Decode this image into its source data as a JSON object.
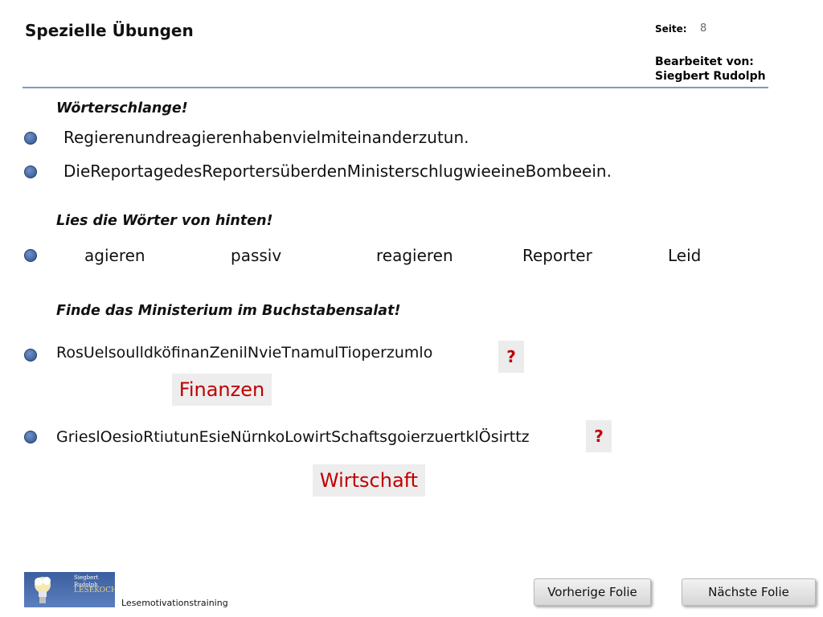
{
  "header": {
    "title": "Spezielle Übungen",
    "page_label": "Seite:",
    "page_number": "8",
    "edited_by_label": "Bearbeitet von:",
    "author": "Siegbert Rudolph"
  },
  "section1": {
    "heading": "Wörterschlange!",
    "lines": [
      "Regierenundreagierenhabenvielmiteinanderzutun.",
      "DieReportagedesReportersüberdenMinisterschlugwieeineBombeein."
    ]
  },
  "section2": {
    "heading": "Lies die Wörter von hinten!",
    "words": [
      "agieren",
      "passiv",
      "reagieren",
      "Reporter",
      "Leid"
    ]
  },
  "section3": {
    "heading": "Finde das Ministerium im Buchstabensalat!",
    "puzzles": [
      {
        "letters": "RosUelsoulldköfinanZenilNvieTnamulTioperzumlo",
        "question": "?",
        "answer": "Finanzen"
      },
      {
        "letters": "GrieslOesioRtiutunEsieNürnkoLowirtSchaftsgoierzuertklÖsirttz",
        "question": "?",
        "answer": "Wirtschaft"
      }
    ]
  },
  "footer": {
    "logo_small_text": "Siegbert Rudolph",
    "logo_brand": "LESEKOCH",
    "caption": "Lesemotivationstraining",
    "prev_label": "Vorherige Folie",
    "next_label": "Nächste Folie"
  },
  "colors": {
    "accent_rule": "#7d9bbd",
    "bullet": "#4a6fa8",
    "answer_red": "#c00000"
  }
}
